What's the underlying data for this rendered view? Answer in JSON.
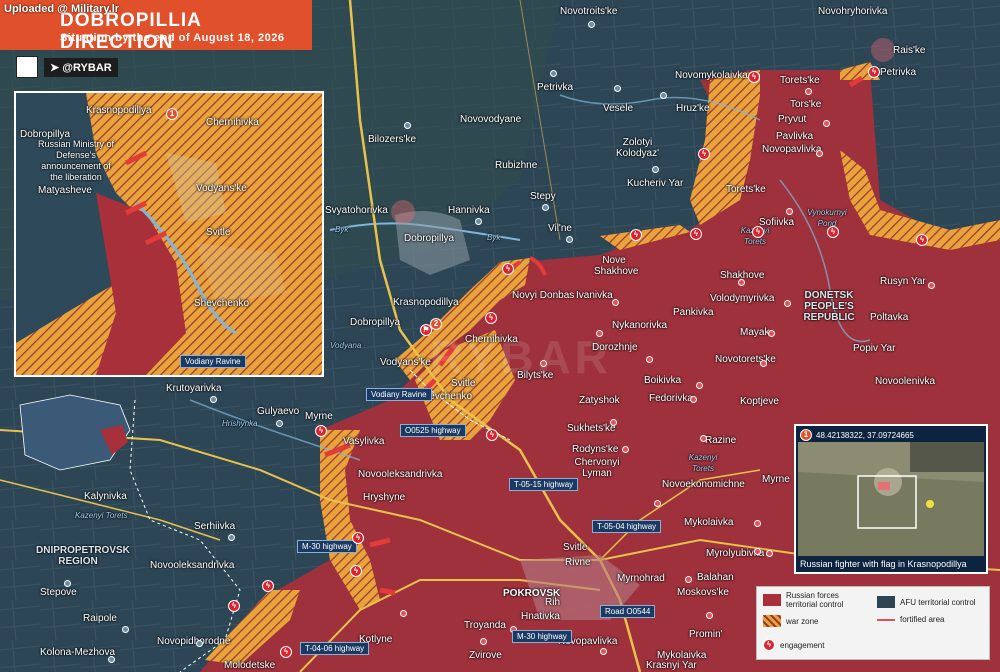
{
  "uploaded_by": "Uploaded @ Military.lr",
  "header": {
    "title": "DOBROPILLIA DIRECTION",
    "subtitle": "Situation by the end of August 18, 2026"
  },
  "brand": {
    "handle": "@RYBAR"
  },
  "colors": {
    "russian": "#a8303a",
    "warzone": "#e8a33c",
    "afu": "#2c4454",
    "header": "#e0502a",
    "road": "#1b3a63"
  },
  "settlements": [
    {
      "name": "Novotroits'ke",
      "side": "afu"
    },
    {
      "name": "Novohryhorivka",
      "side": "afu"
    },
    {
      "name": "Rais'ke",
      "side": "ru"
    },
    {
      "name": "Petrivka",
      "side": "afu"
    },
    {
      "name": "Petrivka",
      "side": "ru"
    },
    {
      "name": "Novomykolaivka",
      "side": "afu"
    },
    {
      "name": "Torets'ke",
      "side": "ru"
    },
    {
      "name": "Vesele",
      "side": "afu"
    },
    {
      "name": "Hruz'ke",
      "side": "afu"
    },
    {
      "name": "Novovodyane",
      "side": "afu"
    },
    {
      "name": "Tors'ke",
      "side": "ru"
    },
    {
      "name": "Pryvut",
      "side": "ru"
    },
    {
      "name": "Pavlivka",
      "side": "ru"
    },
    {
      "name": "Novopavlivka",
      "side": "ru"
    },
    {
      "name": "Bilozers'ke",
      "side": "afu"
    },
    {
      "name": "Zolotyi Kolodyaz'",
      "side": "afu"
    },
    {
      "name": "Rubizhne",
      "side": "afu"
    },
    {
      "name": "Kucheriv Yar",
      "side": "afu"
    },
    {
      "name": "Torets'ke",
      "side": "ru"
    },
    {
      "name": "Stepy",
      "side": "afu"
    },
    {
      "name": "Svyatohorivka",
      "side": "afu"
    },
    {
      "name": "Hannivka",
      "side": "afu"
    },
    {
      "name": "Sofiivka",
      "side": "ru"
    },
    {
      "name": "Dobropillya",
      "side": "afu"
    },
    {
      "name": "Vil'ne",
      "side": "afu"
    },
    {
      "name": "Nove Shakhove",
      "side": "ru"
    },
    {
      "name": "Shakhove",
      "side": "ru"
    },
    {
      "name": "Rusyn Yar",
      "side": "ru"
    },
    {
      "name": "Novyi Donbas",
      "side": "ru"
    },
    {
      "name": "Ivanivka",
      "side": "ru"
    },
    {
      "name": "Volodymyrivka",
      "side": "ru"
    },
    {
      "name": "Poltavka",
      "side": "ru"
    },
    {
      "name": "Krasnopodillya",
      "side": "afu"
    },
    {
      "name": "Pankivka",
      "side": "ru"
    },
    {
      "name": "Nykanorivka",
      "side": "ru"
    },
    {
      "name": "Mayak",
      "side": "ru"
    },
    {
      "name": "Popiv Yar",
      "side": "ru"
    },
    {
      "name": "Dobropillya",
      "side": "afu"
    },
    {
      "name": "Chernihivka",
      "side": "ru"
    },
    {
      "name": "Dorozhnje",
      "side": "ru"
    },
    {
      "name": "Vodyans'ke",
      "side": "ru"
    },
    {
      "name": "Novotorets'ke",
      "side": "ru"
    },
    {
      "name": "Bilyts'ke",
      "side": "ru"
    },
    {
      "name": "Svitle",
      "side": "ru"
    },
    {
      "name": "Boikivka",
      "side": "ru"
    },
    {
      "name": "Novoolenivka",
      "side": "ru"
    },
    {
      "name": "Krutoyarivka",
      "side": "afu"
    },
    {
      "name": "Shevchenko",
      "side": "ru"
    },
    {
      "name": "Fedorivka",
      "side": "ru"
    },
    {
      "name": "Koptjeve",
      "side": "ru"
    },
    {
      "name": "Gulyaevo",
      "side": "afu"
    },
    {
      "name": "Myrne",
      "side": "afu"
    },
    {
      "name": "Zatyshok",
      "side": "ru"
    },
    {
      "name": "Sukhets'ke",
      "side": "ru"
    },
    {
      "name": "Razine",
      "side": "ru"
    },
    {
      "name": "Vasylivka",
      "side": "ru"
    },
    {
      "name": "Rodyns'ke",
      "side": "ru"
    },
    {
      "name": "Chervonyi Lyman",
      "side": "ru"
    },
    {
      "name": "Novooleksandrivka",
      "side": "ru"
    },
    {
      "name": "Myrne",
      "side": "ru"
    },
    {
      "name": "Novoekonomichne",
      "side": "ru"
    },
    {
      "name": "Kalynivka",
      "side": "afu"
    },
    {
      "name": "Hryshyne",
      "side": "ru"
    },
    {
      "name": "Mykolaivka",
      "side": "ru"
    },
    {
      "name": "Serhiivka",
      "side": "afu"
    },
    {
      "name": "Svitle",
      "side": "ru"
    },
    {
      "name": "Myrolyubivka",
      "side": "ru"
    },
    {
      "name": "Novooleksandrivka",
      "side": "afu"
    },
    {
      "name": "Rivne",
      "side": "ru"
    },
    {
      "name": "Myrnohrad",
      "side": "ru"
    },
    {
      "name": "Balahan",
      "side": "ru"
    },
    {
      "name": "Moskovs'ke",
      "side": "ru"
    },
    {
      "name": "Stepove",
      "side": "afu"
    },
    {
      "name": "POKROVSK",
      "side": "ru"
    },
    {
      "name": "Rih",
      "side": "ru"
    },
    {
      "name": "Hnativka",
      "side": "ru"
    },
    {
      "name": "Raipole",
      "side": "afu"
    },
    {
      "name": "Troyanda",
      "side": "ru"
    },
    {
      "name": "Promin'",
      "side": "ru"
    },
    {
      "name": "Novopidhorodne",
      "side": "afu"
    },
    {
      "name": "Kotlyne",
      "side": "ru"
    },
    {
      "name": "Novopavlivka",
      "side": "ru"
    },
    {
      "name": "Kolona-Mezhova",
      "side": "afu"
    },
    {
      "name": "Zvirove",
      "side": "ru"
    },
    {
      "name": "Mykolaivka",
      "side": "ru"
    },
    {
      "name": "Molodetske",
      "side": "ru"
    },
    {
      "name": "Krasnyi Yar",
      "side": "ru"
    }
  ],
  "regions": [
    {
      "name": "DONETSK PEOPLE'S REPUBLIC"
    },
    {
      "name": "DNIPROPETROVSK REGION"
    }
  ],
  "water_labels": [
    {
      "name": "Vynokurnyi Pond"
    },
    {
      "name": "Kazenyi Torets"
    },
    {
      "name": "Kazenyi Torets"
    },
    {
      "name": "Byk"
    },
    {
      "name": "Byk"
    },
    {
      "name": "Hrishynka"
    },
    {
      "name": "Vodyana"
    },
    {
      "name": "Kazenyi Torets"
    }
  ],
  "roads": [
    {
      "name": "O0525 highway"
    },
    {
      "name": "T-05-15 highway"
    },
    {
      "name": "T-05-04 highway"
    },
    {
      "name": "M-30 highway"
    },
    {
      "name": "Road O0544"
    },
    {
      "name": "M-30 highway"
    },
    {
      "name": "T-04-06 highway"
    }
  ],
  "ravine_label": "Vodiany Ravine",
  "inset": {
    "labels": [
      {
        "name": "Dobropillya",
        "side": "afu"
      },
      {
        "name": "Krasnopodillya",
        "side": "afu"
      },
      {
        "name": "Chernihivka",
        "side": "ru"
      },
      {
        "name": "Matyasheve",
        "side": "afu"
      },
      {
        "name": "Vodyans'ke",
        "side": "ru"
      },
      {
        "name": "Svitle",
        "side": "ru"
      },
      {
        "name": "Shevchenko",
        "side": "ru"
      }
    ],
    "note": "Russian Ministry of Defense's announcement of the liberation",
    "ravine": "Vodiany Ravine",
    "badge": "1",
    "badge2": "2"
  },
  "photo": {
    "badge": "1",
    "coordinates": "48.42138322, 37.09724665",
    "caption": "Russian fighter with flag in Krasnopodillya"
  },
  "legend": {
    "ru": "Russian forces territorial control",
    "afu": "AFU territorial control",
    "warzone": "war zone",
    "fortified": "fortified area",
    "engagement": "engagement"
  },
  "watermark": "RYBAR"
}
